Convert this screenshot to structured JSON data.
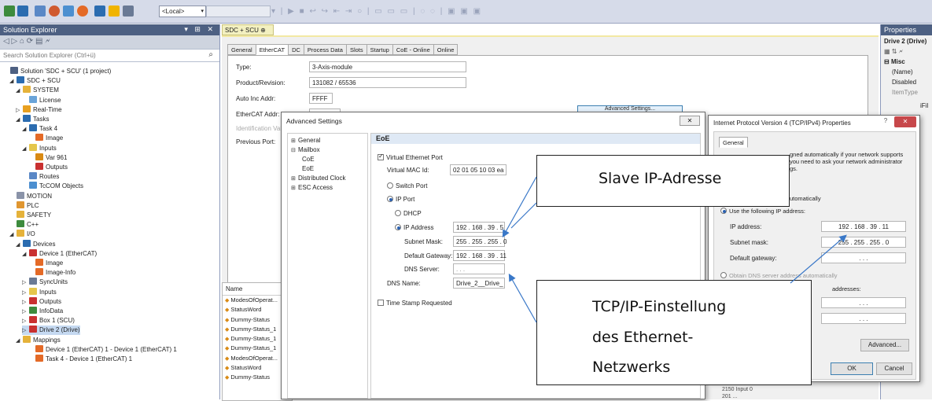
{
  "toolbar": {
    "local_select": "<Local>"
  },
  "solution_explorer": {
    "title": "Solution Explorer",
    "search_placeholder": "Search Solution Explorer (Ctrl+ü)",
    "tree": [
      "Solution 'SDC + SCU' (1 project)",
      "SDC + SCU",
      "SYSTEM",
      "License",
      "Real-Time",
      "Tasks",
      "Task 4",
      "Image",
      "Inputs",
      "Var 961",
      "Outputs",
      "Routes",
      "TcCOM Objects",
      "MOTION",
      "PLC",
      "SAFETY",
      "C++",
      "I/O",
      "Devices",
      "Device 1 (EtherCAT)",
      "Image",
      "Image-Info",
      "SyncUnits",
      "Inputs",
      "Outputs",
      "InfoData",
      "Box 1 (SCU)",
      "Drive 2 (Drive)",
      "Mappings",
      "Device 1 (EtherCAT) 1 - Device 1 (EtherCAT) 1",
      "Task 4 - Device 1 (EtherCAT) 1"
    ]
  },
  "document": {
    "tab_label": "SDC + SCU",
    "tabs": [
      "General",
      "EtherCAT",
      "DC",
      "Process Data",
      "Slots",
      "Startup",
      "CoE - Online",
      "Online"
    ],
    "fields": {
      "type_label": "Type:",
      "type_value": "3-Axis-module",
      "product_label": "Product/Revision:",
      "product_value": "131082 / 65536",
      "autoinc_label": "Auto Inc Addr:",
      "autoinc_value": "FFFF",
      "ecat_label": "EtherCAT Addr:",
      "ecat_value": "1002",
      "ident_label": "Identification Value",
      "prev_label": "Previous Port:",
      "advanced_button": "Advanced Settings..."
    },
    "object_list": {
      "header": "Name",
      "rows": [
        "ModesOfOperat...",
        "StatusWord",
        "Dummy-Status",
        "Dummy-Status_1",
        "Dummy-Status_1",
        "Dummy-Status_1",
        "ModesOfOperat...",
        "StatusWord",
        "Dummy-Status"
      ]
    }
  },
  "properties": {
    "title": "Properties",
    "object": "Drive 2 (Drive)",
    "section": "Misc",
    "rows": [
      "(Name)",
      "Disabled",
      "ItemType"
    ],
    "partial": "iFil"
  },
  "advanced_dialog": {
    "title": "Advanced Settings",
    "close": "✕",
    "tree": [
      "General",
      "Mailbox",
      "CoE",
      "EoE",
      "Distributed Clock",
      "ESC Access"
    ],
    "section": "EoE",
    "virtual_port": "Virtual Ethernet Port",
    "mac_label": "Virtual MAC Id:",
    "mac_value": "02 01 05 10 03 ea",
    "switch_port": "Switch Port",
    "ip_port": "IP Port",
    "dhcp": "DHCP",
    "ip_label": "IP Address",
    "ip_value": "192 . 168 . 39 . 5",
    "subnet_label": "Subnet Mask:",
    "subnet_value": "255 . 255 . 255 . 0",
    "gateway_label": "Default Gateway:",
    "gateway_value": "192 . 168 . 39 . 11",
    "dns_label": "DNS Server:",
    "dns_value": ". . .",
    "dnsname_label": "DNS Name:",
    "dnsname_value": "Drive_2__Drive_",
    "timestamp": "Time Stamp Requested"
  },
  "tcp_dialog": {
    "title": "Internet Protocol Version 4 (TCP/IPv4) Properties",
    "help": "?",
    "close": "✕",
    "tab": "General",
    "intro_1": "gned automatically if your network supports",
    "intro_2": "you need to ask your network administrator",
    "intro_3": "gs.",
    "auto_partial": "utomatically",
    "use_following": "Use the following IP address:",
    "ip_label": "IP address:",
    "ip_value": "192 . 168 . 39 . 11",
    "subnet_label": "Subnet mask:",
    "subnet_value": "255 . 255 . 255 . 0",
    "gateway_label": "Default gateway:",
    "gateway_value": ". . .",
    "obtain_dns": "Obtain DNS server address automatically",
    "use_dns_partial": "addresses:",
    "dns_pref_value": ". . .",
    "dns_alt_value": ". . .",
    "advanced_button": "Advanced...",
    "ok_button": "OK",
    "cancel_button": "Cancel",
    "bottom_1": "2150 Input 0",
    "bottom_2": "201 ..."
  },
  "callouts": {
    "slave_ip": "Slave IP-Adresse",
    "tcp_line1": "TCP/IP-Einstellung",
    "tcp_line2": "des Ethernet-",
    "tcp_line3": "Netzwerks"
  },
  "colors": {
    "accent": "#3a78c8",
    "panel_header": "#4d6082",
    "tab_yellow": "#f3f0c0"
  }
}
